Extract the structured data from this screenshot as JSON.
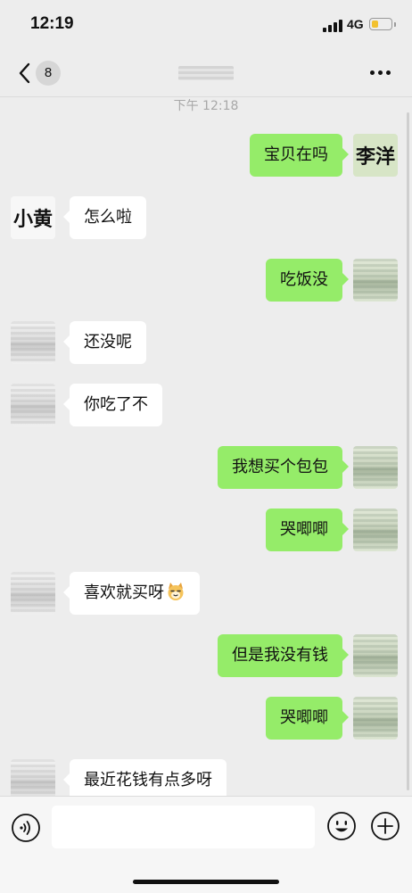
{
  "status_bar": {
    "time": "12:19",
    "network": "4G",
    "battery_level": 0.35
  },
  "nav": {
    "unread_count": "8",
    "title_blurred": true
  },
  "timestamp": "下午 12:18",
  "avatars": {
    "me_name": "李洋",
    "friend_name": "小黄"
  },
  "messages": [
    {
      "side": "right",
      "text": "宝贝在吗",
      "avatar": "name"
    },
    {
      "side": "left",
      "text": "怎么啦",
      "avatar": "name"
    },
    {
      "side": "right",
      "text": "吃饭没",
      "avatar": "blur"
    },
    {
      "side": "left",
      "text": "还没呢",
      "avatar": "blur"
    },
    {
      "side": "left",
      "text": "你吃了不",
      "avatar": "blur"
    },
    {
      "side": "right",
      "text": "我想买个包包",
      "avatar": "blur"
    },
    {
      "side": "right",
      "text": "哭唧唧",
      "avatar": "blur"
    },
    {
      "side": "left",
      "text": "喜欢就买呀",
      "avatar": "blur",
      "emoji": "cat-face-emoji"
    },
    {
      "side": "right",
      "text": "但是我没有钱",
      "avatar": "blur"
    },
    {
      "side": "right",
      "text": "哭唧唧",
      "avatar": "blur"
    },
    {
      "side": "left",
      "text": "最近花钱有点多呀",
      "avatar": "blur"
    }
  ],
  "input": {
    "value": "",
    "placeholder": ""
  },
  "icons": {
    "back": "chevron-left-icon",
    "more": "more-dots-icon",
    "voice": "voice-icon",
    "emoji": "emoji-icon",
    "plus": "plus-icon"
  },
  "colors": {
    "my_bubble": "#95ec69",
    "their_bubble": "#ffffff",
    "background": "#ededed"
  }
}
